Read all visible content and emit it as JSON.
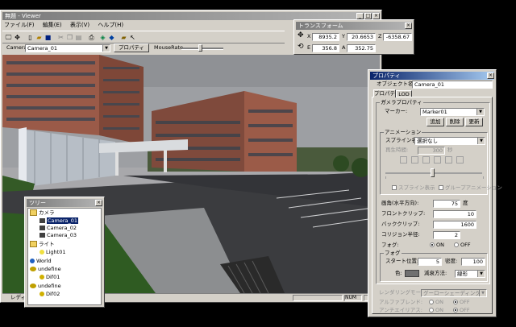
{
  "viewer": {
    "title": "無題 - Viewer",
    "menu": [
      "ファイル(F)",
      "編集(E)",
      "表示(V)",
      "ヘルプ(H)"
    ],
    "toolbar2": {
      "camera_label": "Camera",
      "camera_value": "Camera_01",
      "properties_button": "プロパティ",
      "mouserate_label": "MouseRate",
      "mouserate_level": 0.45
    },
    "status": {
      "ready": "レディ",
      "num": "NUM"
    }
  },
  "transform": {
    "title": "トランスフォーム",
    "row1": {
      "x_label": "X",
      "x_value": "8935.2",
      "y_label": "Y",
      "y_value": "20.6653",
      "z_label": "Z",
      "z_value": "-6358.67"
    },
    "row2": {
      "e_label": "E",
      "e_value": "356.8",
      "a_label": "A",
      "a_value": "352.75"
    }
  },
  "tree": {
    "title": "ツリー",
    "items": [
      {
        "label": "カメラ",
        "type": "folder",
        "level": 1
      },
      {
        "label": "Camera_01",
        "type": "camera",
        "level": 2,
        "selected": true
      },
      {
        "label": "Camera_02",
        "type": "camera",
        "level": 2
      },
      {
        "label": "Camera_03",
        "type": "camera",
        "level": 2
      },
      {
        "label": "ライト",
        "type": "folder",
        "level": 1
      },
      {
        "label": "Light01",
        "type": "light",
        "level": 2
      },
      {
        "label": "World",
        "type": "world",
        "level": 1
      },
      {
        "label": "undefine",
        "type": "group",
        "level": 1
      },
      {
        "label": "Dif01",
        "type": "object",
        "level": 2
      },
      {
        "label": "undefine",
        "type": "group",
        "level": 1
      },
      {
        "label": "Dif02",
        "type": "object",
        "level": 2
      }
    ]
  },
  "props": {
    "title": "プロパティ",
    "object_name_label": "オブジェクト名:",
    "object_name_value": "Camera_01",
    "tabs": [
      "プロパティ",
      "LOD"
    ],
    "camera_group": "カメラプロパティ",
    "marker_label": "マーカー:",
    "marker_value": "Marker01",
    "add_button": "追加",
    "delete_button": "削除",
    "update_button": "更新",
    "anim_group": "アニメーション",
    "spline_label": "スプライン名:",
    "spline_value": "選択なし",
    "playtime_label": "再生時間:",
    "playtime_value": "300",
    "playtime_unit": "秒",
    "spline_show": "スプライン表示",
    "group_anim": "グループアニメーション",
    "fov_label": "画角(水平方向):",
    "fov_value": "75",
    "fov_unit": "度",
    "front_clip_label": "フロントクリップ:",
    "front_clip_value": "10",
    "back_clip_label": "バッククリップ:",
    "back_clip_value": "1600",
    "collision_label": "コリジョン半径:",
    "collision_value": "2",
    "fog_label": "フォグ:",
    "fog_on": "ON",
    "fog_off": "OFF",
    "fog_group": "フォグ",
    "start_label": "スタート位置:",
    "start_value": "5",
    "density_label": "密度:",
    "density_value": "100",
    "color_label": "色:",
    "attn_label": "減衰方法:",
    "attn_value": "線形",
    "render_label": "レンダリングモード:",
    "render_value": "グーローシェーディング",
    "alpha_label": "アルファブレンド:",
    "alpha_on": "ON",
    "alpha_off": "OFF",
    "aa_label": "アンチエイリアス:",
    "aa_on": "ON",
    "aa_off": "OFF"
  }
}
